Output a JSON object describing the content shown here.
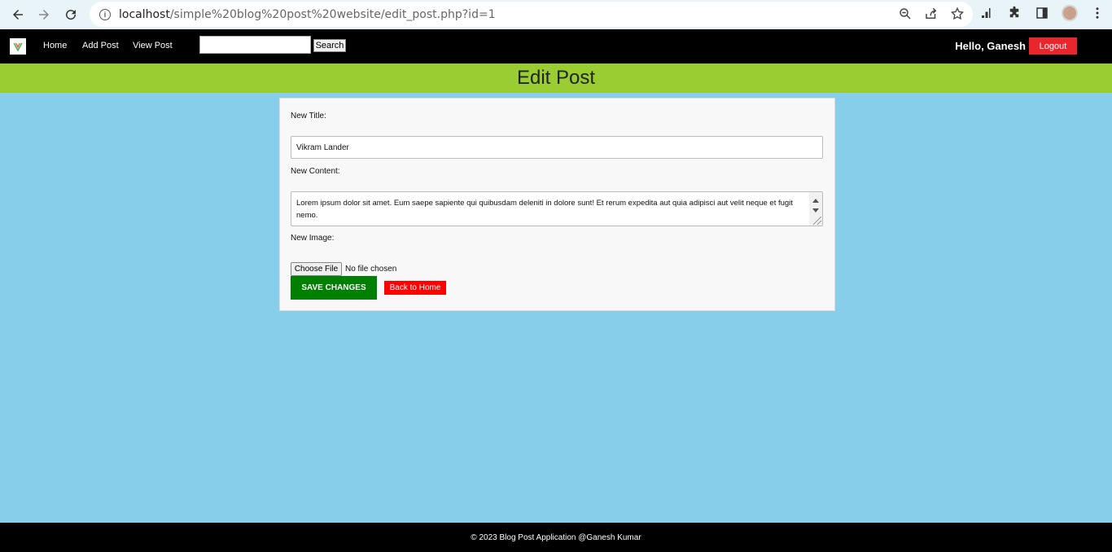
{
  "browser": {
    "url_host": "localhost",
    "url_path": "/simple%20blog%20post%20website/edit_post.php?id=1"
  },
  "nav": {
    "links": [
      "Home",
      "Add Post",
      "View Post"
    ],
    "search_button": "Search",
    "greeting": "Hello, Ganesh",
    "logout": "Logout"
  },
  "banner": {
    "title": "Edit Post"
  },
  "form": {
    "title_label": "New Title:",
    "title_value": "Vikram Lander",
    "content_label": "New Content:",
    "content_value": "Lorem ipsum dolor sit amet. Eum saepe sapiente qui quibusdam deleniti in dolore sunt! Et rerum expedita aut quia adipisci aut velit neque et fugit nemo.",
    "image_label": "New Image:",
    "file_button": "Choose File",
    "file_status": "No file chosen",
    "save_button": "SAVE CHANGES",
    "back_button": "Back to Home"
  },
  "footer": {
    "text": "© 2023 Blog Post Application @Ganesh Kumar"
  }
}
